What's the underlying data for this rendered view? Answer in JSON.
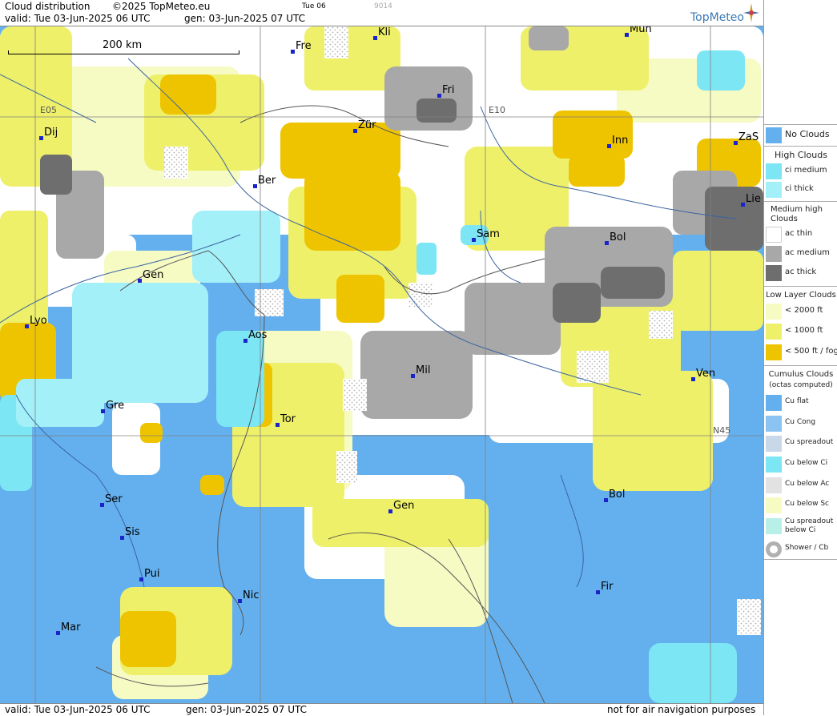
{
  "header": {
    "title": "Cloud distribution",
    "copyright": "©2025 TopMeteo.eu",
    "day": "Tue 06",
    "code": "9014",
    "valid": "valid:  Tue   03-Jun-2025   06 UTC",
    "gen": "gen: 03-Jun-2025 07 UTC",
    "brand": "TopMeteo"
  },
  "footer": {
    "valid": "valid:  Tue   03-Jun-2025   06 UTC",
    "gen": "gen: 03-Jun-2025 07 UTC",
    "note": "not for air navigation purposes"
  },
  "map": {
    "scale_label": "200 km",
    "gridlines": [
      "E05",
      "E10",
      "N45"
    ],
    "cities": [
      "Kli",
      "Mün",
      "Fre",
      "Fri",
      "Dij",
      "Zür",
      "Inn",
      "ZaS",
      "Ber",
      "Lie",
      "Sam",
      "Bol",
      "Gen",
      "Lyo",
      "Aos",
      "Mil",
      "Ven",
      "Gre",
      "Tor",
      "Ser",
      "Gen",
      "Bol",
      "Sis",
      "Pui",
      "Nic",
      "Fir",
      "Mar"
    ]
  },
  "legend": {
    "no_clouds": "No Clouds",
    "high_title": "High Clouds",
    "ci_medium": "ci medium",
    "ci_thick": "ci thick",
    "medium_title": "Medium high Clouds",
    "ac_thin": "ac thin",
    "ac_medium": "ac medium",
    "ac_thick": "ac thick",
    "low_title": "Low Layer Clouds",
    "low_2000": "< 2000 ft",
    "low_1000": "< 1000 ft",
    "low_500": "< 500 ft / fog",
    "cu_title": "Cumulus Clouds",
    "cu_sub": "(octas computed)",
    "cu_flat": "Cu flat",
    "cu_cong": "Cu Cong",
    "cu_spreadout": "Cu spreadout",
    "cu_below_ci": "Cu below Ci",
    "cu_below_ac": "Cu below Ac",
    "cu_below_sc": "Cu below Sc",
    "cu_spreadout_below_ci": "Cu spreadout below Ci",
    "shower": "Shower / Cb"
  },
  "colors": {
    "no_clouds": "#64b0ee",
    "ci_medium": "#7ce6f4",
    "ci_thick": "#a4f0f8",
    "ac_thin": "#ffffff",
    "ac_medium": "#a8a8a8",
    "ac_thick": "#6e6e6e",
    "low_2000": "#f6fbc4",
    "low_1000": "#eef06a",
    "low_500": "#eec400"
  }
}
